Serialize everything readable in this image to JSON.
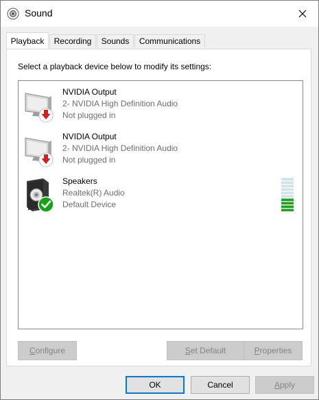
{
  "window": {
    "title": "Sound"
  },
  "tabs": [
    {
      "label": "Playback",
      "active": true
    },
    {
      "label": "Recording",
      "active": false
    },
    {
      "label": "Sounds",
      "active": false
    },
    {
      "label": "Communications",
      "active": false
    }
  ],
  "playback": {
    "instruction": "Select a playback device below to modify its settings:",
    "devices": [
      {
        "name": "NVIDIA Output",
        "driver": "2- NVIDIA High Definition Audio",
        "status": "Not plugged in",
        "icon": "monitor-icon",
        "badge": "red-down-arrow-badge"
      },
      {
        "name": "NVIDIA Output",
        "driver": "2- NVIDIA High Definition Audio",
        "status": "Not plugged in",
        "icon": "monitor-icon",
        "badge": "red-down-arrow-badge"
      },
      {
        "name": "Speakers",
        "driver": "Realtek(R) Audio",
        "status": "Default Device",
        "icon": "speaker-icon",
        "badge": "green-check-badge",
        "level_bars_lit": 4,
        "level_bars_total": 10
      }
    ],
    "buttons": {
      "configure": {
        "pre": "",
        "ul": "C",
        "post": "onfigure"
      },
      "set_default": {
        "pre": "",
        "ul": "S",
        "post": "et Default"
      },
      "properties": {
        "pre": "",
        "ul": "P",
        "post": "roperties"
      }
    }
  },
  "dialog_buttons": {
    "ok": "OK",
    "cancel": "Cancel",
    "apply": {
      "pre": "",
      "ul": "A",
      "post": "pply"
    }
  },
  "colors": {
    "accent": "#0078d7",
    "meter_lit": "#21a121",
    "meter_unlit": "#cfe3ea",
    "badge_red": "#d21f1f",
    "badge_green": "#17a317"
  }
}
